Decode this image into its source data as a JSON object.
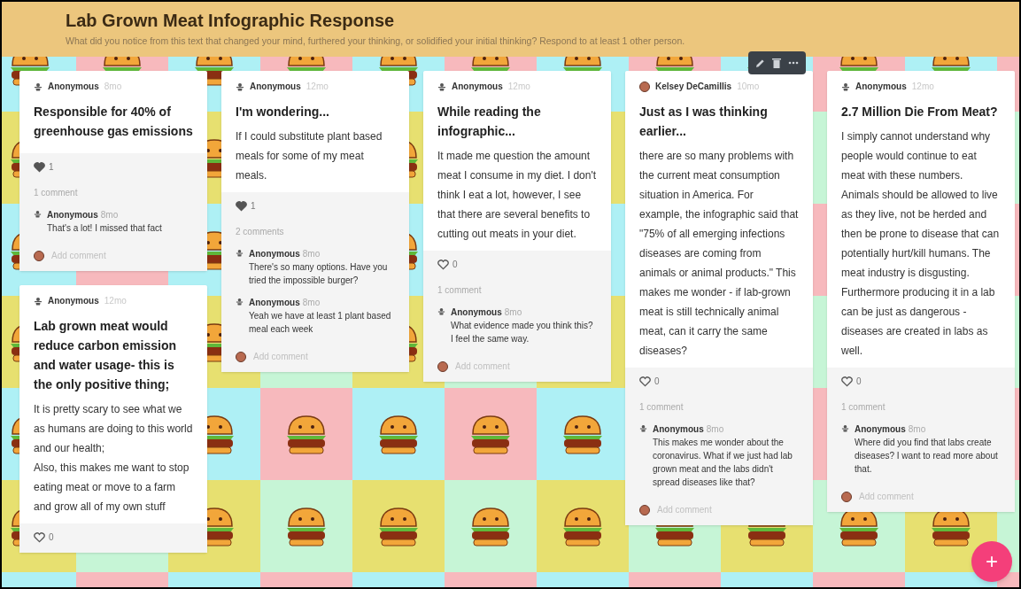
{
  "board": {
    "title": "Lab Grown Meat Infographic Response",
    "description": "What did you notice from this text that changed your mind, furthered your thinking, or solidified your initial thinking? Respond to at least 1 other person."
  },
  "columns": [
    {
      "posts": [
        {
          "author": {
            "name": "Anonymous",
            "kind": "anonymous"
          },
          "time": "8mo",
          "title": "Responsible for 40% of greenhouse gas emissions",
          "hovered": false,
          "reactions": {
            "liked": true,
            "count": "1"
          },
          "comment_count": "1 comment",
          "comments": [
            {
              "author": "Anonymous",
              "time": "8mo",
              "text": "That's a lot! I missed that fact"
            }
          ],
          "add_comment": {
            "placeholder": "Add comment"
          }
        },
        {
          "author": {
            "name": "Anonymous",
            "kind": "anonymous"
          },
          "time": "12mo",
          "title": "Lab grown meat would reduce carbon emission and water usage- this is the only positive thing;",
          "body": [
            "It is pretty scary to see what we as humans are doing to this world and our health;",
            "Also, this makes me want to stop eating meat or move to a farm and grow all of my own stuff"
          ],
          "hovered": false,
          "reactions": {
            "liked": false,
            "count": "0"
          }
        }
      ]
    },
    {
      "posts": [
        {
          "author": {
            "name": "Anonymous",
            "kind": "anonymous"
          },
          "time": "12mo",
          "title": "I'm wondering...",
          "body": [
            "If I could substitute plant based meals for some of my meat meals."
          ],
          "hovered": false,
          "reactions": {
            "liked": true,
            "count": "1"
          },
          "comment_count": "2 comments",
          "comments": [
            {
              "author": "Anonymous",
              "time": "8mo",
              "text": "There's so many options. Have you tried the impossible burger?"
            },
            {
              "author": "Anonymous",
              "time": "8mo",
              "text": "Yeah we have at least 1 plant based meal each week"
            }
          ],
          "add_comment": {
            "placeholder": "Add comment"
          }
        }
      ]
    },
    {
      "posts": [
        {
          "author": {
            "name": "Anonymous",
            "kind": "anonymous"
          },
          "time": "12mo",
          "title": "While reading the infographic...",
          "body": [
            "It made me question the amount meat I consume in my diet. I don't think I eat a lot, however, I see that there are several benefits to cutting out meats in your diet."
          ],
          "hovered": false,
          "reactions": {
            "liked": false,
            "count": "0"
          },
          "comment_count": "1 comment",
          "comments": [
            {
              "author": "Anonymous",
              "time": "8mo",
              "text": "What evidence made you think this? I feel the same way."
            }
          ],
          "add_comment": {
            "placeholder": "Add comment"
          }
        }
      ]
    },
    {
      "posts": [
        {
          "author": {
            "name": "Kelsey DeCamillis",
            "kind": "photo"
          },
          "time": "10mo",
          "title": "Just as I was thinking earlier...",
          "body": [
            "there are so many problems with the current meat consumption situation in America. For example, the infographic said that \"75% of all emerging infections diseases are coming from animals or animal products.\" This makes me wonder - if lab-grown meat is still technically animal meat, can it carry the same diseases?"
          ],
          "hovered": true,
          "reactions": {
            "liked": false,
            "count": "0"
          },
          "comment_count": "1 comment",
          "comments": [
            {
              "author": "Anonymous",
              "time": "8mo",
              "text": "This makes me wonder about the coronavirus. What if we just had lab grown meat and the labs didn't spread diseases like that?"
            }
          ],
          "add_comment": {
            "placeholder": "Add comment"
          }
        }
      ]
    },
    {
      "posts": [
        {
          "author": {
            "name": "Anonymous",
            "kind": "anonymous"
          },
          "time": "12mo",
          "title": "2.7 Million Die From Meat?",
          "body": [
            "I simply cannot understand why people would continue to eat meat with these numbers. Animals should be allowed to live as they live, not be herded and then be prone to disease that can potentially hurt/kill humans. The meat industry is disgusting. Furthermore producing it in a lab can be just as dangerous - diseases are created in labs as well."
          ],
          "hovered": false,
          "reactions": {
            "liked": false,
            "count": "0"
          },
          "comment_count": "1 comment",
          "comments": [
            {
              "author": "Anonymous",
              "time": "8mo",
              "text": "Where did you find that labs create diseases? I want to read more about that."
            }
          ],
          "add_comment": {
            "placeholder": "Add comment"
          }
        }
      ]
    }
  ],
  "add_button": {
    "label": "+"
  }
}
